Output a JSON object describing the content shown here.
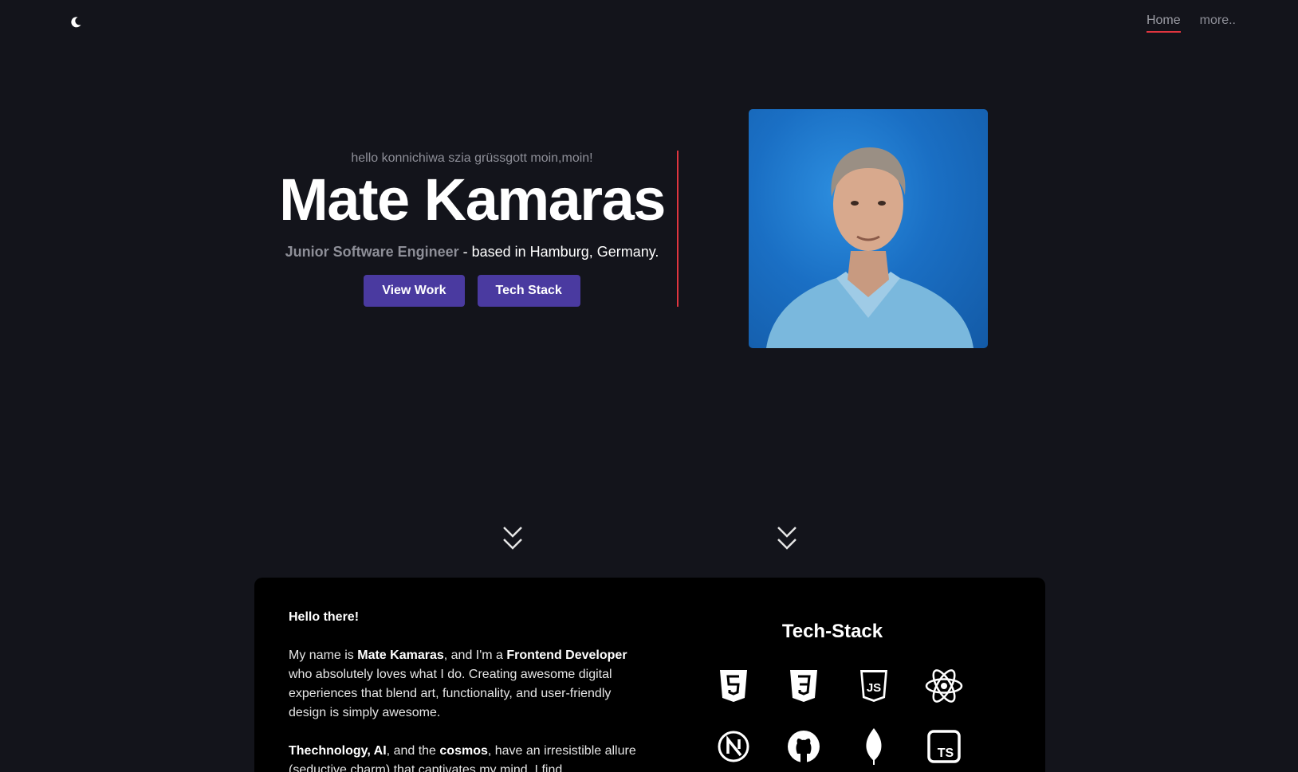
{
  "nav": {
    "theme_icon": "moon-icon",
    "links": [
      "Home",
      "more.."
    ]
  },
  "hero": {
    "greeting": "hello konnichiwa szia grüssgott moin,moin!",
    "name": "Mate Kamaras",
    "role": "Junior Software Engineer",
    "location": " - based in Hamburg, Germany.",
    "buttons": {
      "view_work": "View Work",
      "tech_stack": "Tech Stack"
    },
    "portrait_icon": "portrait-photo"
  },
  "scroll": {
    "icon": "double-chevron-down-icon"
  },
  "about": {
    "heading": "Hello there!",
    "p1": {
      "t1": "My name is ",
      "b1": "Mate Kamaras",
      "t2": ", and I'm a ",
      "b2": "Frontend Developer",
      "t3": " who absolutely loves what I do. Creating awesome digital experiences that blend art, functionality, and user-friendly design is simply awesome."
    },
    "p2": {
      "b1": "Thechnology, AI",
      "t1": ", and the ",
      "b2": "cosmos",
      "t2": ", have an irresistible allure (seductive charm) that captivates my mind. I find"
    }
  },
  "tech_stack": {
    "title": "Tech-Stack",
    "icons": [
      "html5-icon",
      "css3-icon",
      "javascript-icon",
      "react-icon",
      "nextjs-icon",
      "github-icon",
      "mongodb-icon",
      "typescript-icon"
    ]
  },
  "colors": {
    "background": "#13141b",
    "card": "#000000",
    "accent_button": "#4a3aa0",
    "accent_red": "#e0353f",
    "muted_text": "#8e8f98"
  }
}
